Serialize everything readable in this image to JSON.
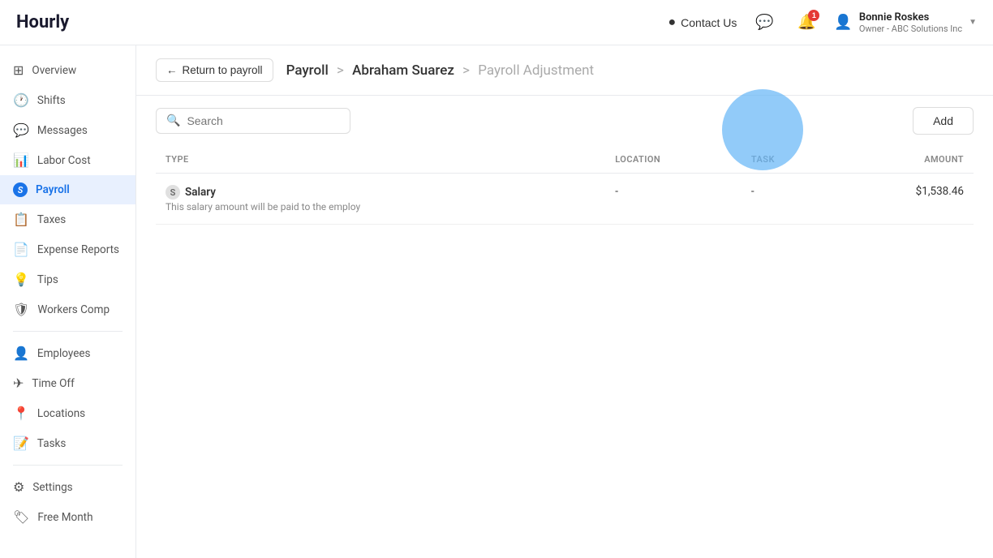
{
  "header": {
    "logo": "Hourly",
    "contact_label": "Contact Us",
    "notification_count": "1",
    "user": {
      "name": "Bonnie Roskes",
      "role": "Owner - ABC Solutions Inc"
    }
  },
  "sidebar": {
    "items": [
      {
        "id": "overview",
        "label": "Overview",
        "icon": "⊞"
      },
      {
        "id": "shifts",
        "label": "Shifts",
        "icon": "🕐"
      },
      {
        "id": "messages",
        "label": "Messages",
        "icon": "💬"
      },
      {
        "id": "labor-cost",
        "label": "Labor Cost",
        "icon": "📊"
      },
      {
        "id": "payroll",
        "label": "Payroll",
        "icon": "💲",
        "active": true
      },
      {
        "id": "taxes",
        "label": "Taxes",
        "icon": "📋"
      },
      {
        "id": "expense-reports",
        "label": "Expense Reports",
        "icon": "📄"
      },
      {
        "id": "tips",
        "label": "Tips",
        "icon": "💡"
      },
      {
        "id": "workers-comp",
        "label": "Workers Comp",
        "icon": "🛡"
      },
      {
        "id": "employees",
        "label": "Employees",
        "icon": "👤"
      },
      {
        "id": "time-off",
        "label": "Time Off",
        "icon": "✈"
      },
      {
        "id": "locations",
        "label": "Locations",
        "icon": "📍"
      },
      {
        "id": "tasks",
        "label": "Tasks",
        "icon": "📝"
      },
      {
        "id": "settings",
        "label": "Settings",
        "icon": "⚙"
      },
      {
        "id": "free-month",
        "label": "Free Month",
        "icon": "🏷"
      }
    ]
  },
  "breadcrumb": {
    "part1": "Payroll",
    "sep1": ">",
    "part2": "Abraham Suarez",
    "sep2": ">",
    "part3": "Payroll Adjustment"
  },
  "return_btn": "Return to payroll",
  "toolbar": {
    "search_placeholder": "Search",
    "add_btn": "Add"
  },
  "table": {
    "columns": [
      {
        "id": "type",
        "label": "TYPE"
      },
      {
        "id": "location",
        "label": "LOCATION"
      },
      {
        "id": "task",
        "label": "TASK"
      },
      {
        "id": "amount",
        "label": "AMOUNT"
      }
    ],
    "rows": [
      {
        "type": "Salary",
        "sub": "This salary amount will be paid to the employ",
        "location": "-",
        "task": "-",
        "amount": "$1,538.46"
      }
    ]
  }
}
